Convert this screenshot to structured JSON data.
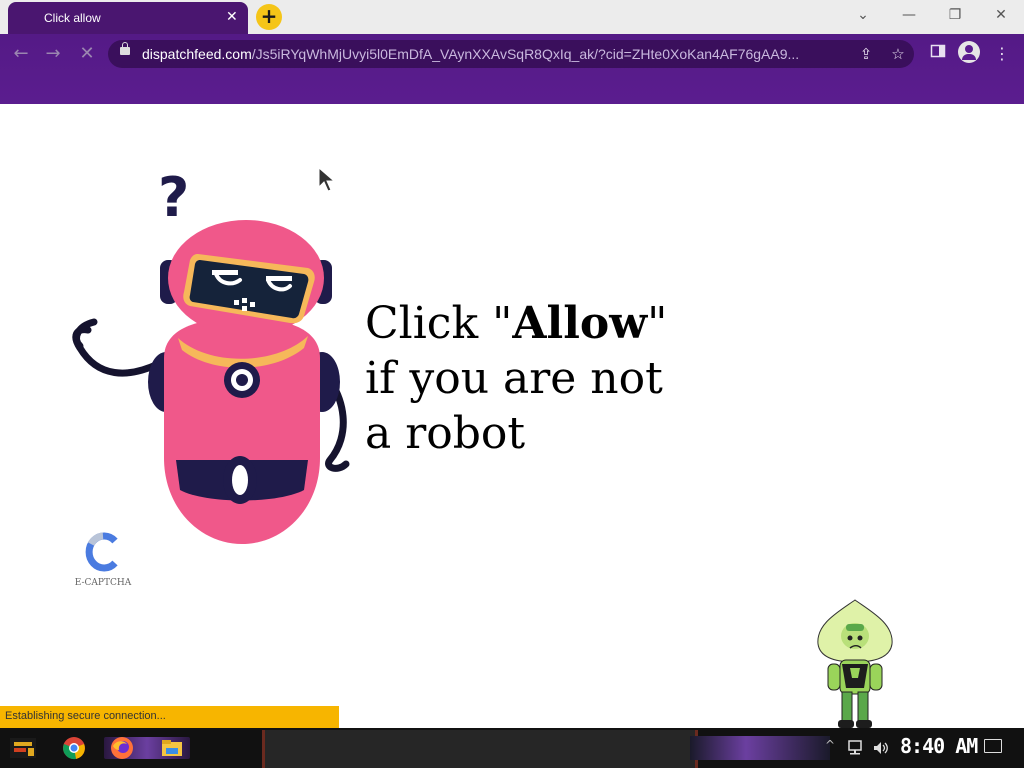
{
  "browser": {
    "tab_title": "Click allow",
    "tab_close": "✕",
    "new_tab": "+",
    "window_controls": {
      "dropdown": "⌄",
      "minimize": "—",
      "restore": "❐",
      "close": "✕"
    },
    "nav": {
      "back": "←",
      "forward": "→",
      "stop": "✕"
    },
    "url_host": "dispatchfeed.com",
    "url_path": "/Js5iRYqWhMjUvyi5l0EmDfA_VAynXXAvSqR8QxIq_ak/?cid=ZHte0XoKan4AF76gAA9...",
    "share_icon": "⇪",
    "bookmark_icon": "☆",
    "menu_icon": "⋮"
  },
  "page": {
    "headline_prefix": "Click \"",
    "headline_bold": "Allow",
    "headline_suffix": "\"",
    "headline_line2": "if you are not",
    "headline_line3": "a robot",
    "robot_question": "?",
    "captcha_label": "E-CAPTCHA"
  },
  "status_bar": {
    "text": "Establishing secure connection..."
  },
  "taskbar": {
    "clock": "8:40 AM",
    "tray_chevron": "^"
  },
  "colors": {
    "tab_bg": "#4a1670",
    "toolbar_bg": "#541a86",
    "robot_pink": "#f0588a",
    "robot_navy": "#1f1b4a",
    "status_bar": "#f7b500",
    "new_tab_button": "#f5c518"
  }
}
